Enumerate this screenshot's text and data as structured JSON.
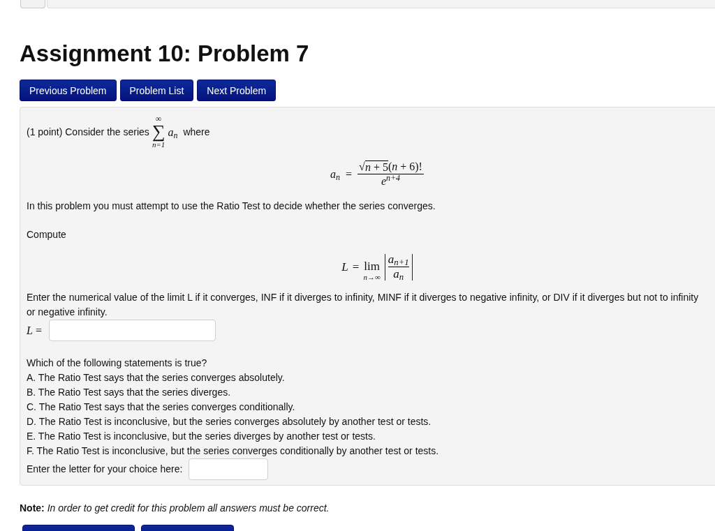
{
  "title": "Assignment 10: Problem 7",
  "nav_buttons": [
    {
      "label": "Previous Problem"
    },
    {
      "label": "Problem List"
    },
    {
      "label": "Next Problem"
    }
  ],
  "problem": {
    "intro": {
      "text": "(1 point) Consider the series",
      "series": {
        "upper": "∞",
        "symbol": "∑",
        "lower": "n=1",
        "term": "*a*$_{n}$"
      },
      "after": "where"
    },
    "term_formula": {
      "lhs": "*a*$_{n}$",
      "equals": "=",
      "numerator": {
        "radical": "√",
        "radicand": "*n* + 5",
        "rest": "(*n* + 6)!"
      },
      "denominator": "*e*$^{n+4}$"
    },
    "instruction": "In this problem you must attempt to use the Ratio Test to decide whether the series converges.",
    "compute_label": "Compute",
    "limit_formula": {
      "lhs": "L",
      "equals": "=",
      "operator": "lim",
      "subscript": "n→∞",
      "numerator": "*a*$_{n+1}$",
      "denominator": "*a*$_{n}$"
    },
    "limit_prompt": "Enter the numerical value of the limit L if it converges, INF if it diverges to infinity, MINF if it diverges to negative infinity, or DIV if it diverges but not to infinity or negative infinity.",
    "limit_answer": {
      "label": "*L* ="
    },
    "question": "Which of the following statements is true?",
    "options": [
      "A. The Ratio Test says that the series converges absolutely.",
      "B. The Ratio Test says that the series diverges.",
      "C. The Ratio Test says that the series converges conditionally.",
      "D. The Ratio Test is inconclusive, but the series converges absolutely by another test or tests.",
      "E. The Ratio Test is inconclusive, but the series diverges by another test or tests.",
      "F. The Ratio Test is inconclusive, but the series converges conditionally by another test or tests."
    ],
    "choice_answer": {
      "label": "Enter the letter for your choice here:"
    }
  },
  "note": "**Note:** *In order to get credit for this problem all answers must be correct.*"
}
